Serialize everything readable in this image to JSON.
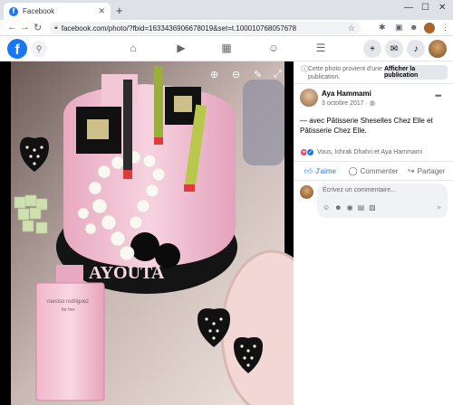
{
  "browser": {
    "tab_title": "Facebook",
    "tab_close": "✕",
    "new_tab": "+",
    "url": "facebook.com/photo/?fbid=1633436906678019&set=t.100010768057678",
    "win_min": "—",
    "win_max": "☐",
    "win_close": "✕"
  },
  "fb_header": {
    "logo": "f",
    "icons": [
      "search-icon",
      "home-icon",
      "watch-icon",
      "marketplace-icon",
      "groups-icon",
      "menu-icon",
      "create-icon",
      "messenger-icon",
      "notifications-icon",
      "account-icon"
    ]
  },
  "panel": {
    "notice": "Cette photo provient d'une publication.",
    "show_publication": "Afficher la publication",
    "author": "Aya Hammami",
    "date": "3 octobre 2017",
    "caption": "— avec Pâtisserie Sheselles Chez Elle et Pâtisserie Chez Elle.",
    "reactions_text": "Vous, Ichrak Dhahri et Aya Hammami",
    "actions": {
      "like": "J'aime",
      "comment": "Commenter",
      "share": "Partager"
    },
    "comment_placeholder": "Écrivez un commentaire..."
  },
  "photo": {
    "cake_text": "AYOUTA",
    "perfume_brand": "narciso rodriguez",
    "perfume_sub": "for her"
  },
  "colors": {
    "fb_blue": "#1877f2",
    "cake_pink": "#f3c6d6",
    "cake_base": "#1a1a1a"
  }
}
